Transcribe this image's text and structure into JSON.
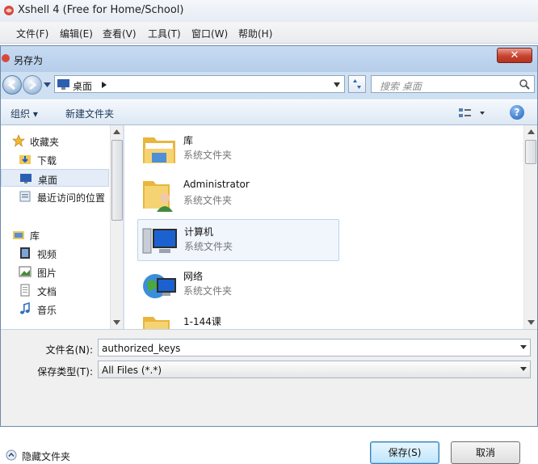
{
  "xshell": {
    "title": "Xshell 4 (Free for Home/School)",
    "menu": [
      "文件(F)",
      "编辑(E)",
      "查看(V)",
      "工具(T)",
      "窗口(W)",
      "帮助(H)"
    ]
  },
  "dialog": {
    "title": "另存为",
    "close": "✕",
    "address": "桌面",
    "search_placeholder": "搜索 桌面",
    "toolbar": {
      "organize": "组织 ▾",
      "new_folder": "新建文件夹"
    },
    "help": "?",
    "nav": {
      "favorites": "收藏夹",
      "downloads": "下载",
      "desktop": "桌面",
      "recent": "最近访问的位置",
      "libraries": "库",
      "videos": "视频",
      "pictures": "图片",
      "documents": "文档",
      "music": "音乐"
    },
    "files": [
      {
        "name": "库",
        "type": "系统文件夹"
      },
      {
        "name": "Administrator",
        "type": "系统文件夹"
      },
      {
        "name": "计算机",
        "type": "系统文件夹"
      },
      {
        "name": "网络",
        "type": "系统文件夹"
      },
      {
        "name": "1-144课",
        "type": ""
      }
    ],
    "filename_label": "文件名(N):",
    "filename_value": "authorized_keys",
    "filetype_label": "保存类型(T):",
    "filetype_value": "All Files (*.*)",
    "hide_folders": "隐藏文件夹",
    "save": "保存(S)",
    "cancel": "取消"
  }
}
